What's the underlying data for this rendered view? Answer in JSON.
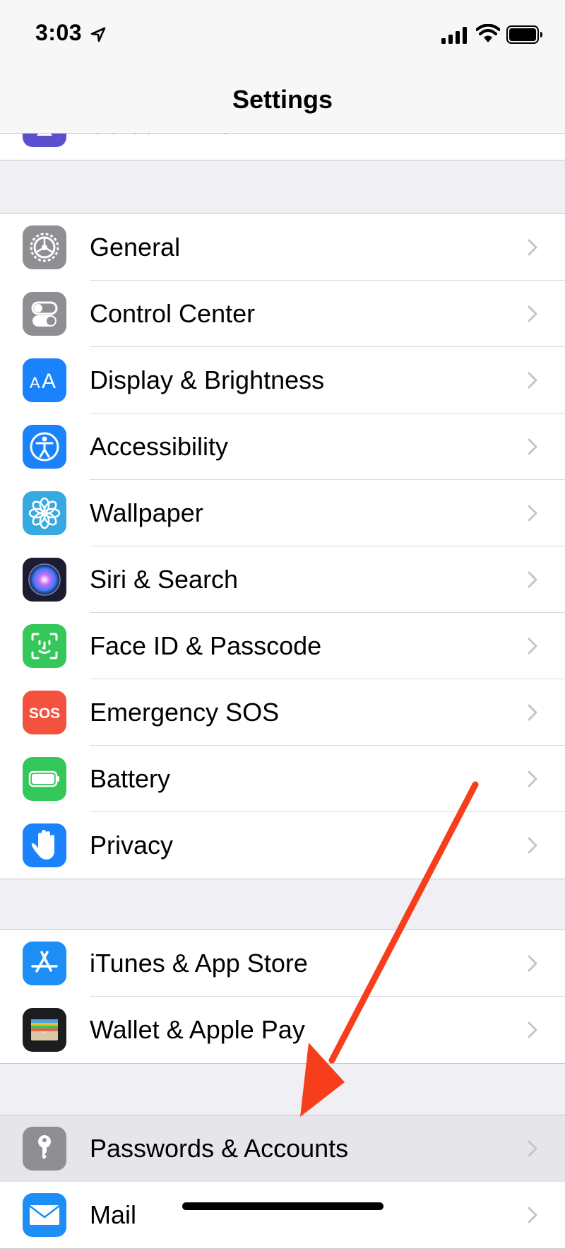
{
  "status": {
    "time": "3:03"
  },
  "nav": {
    "title": "Settings"
  },
  "top_partial": {
    "label": "Screen Time"
  },
  "groups": [
    {
      "items": [
        {
          "label": "General",
          "icon": "gear-icon",
          "color": "#8e8e93"
        },
        {
          "label": "Control Center",
          "icon": "toggles-icon",
          "color": "#8e8e93"
        },
        {
          "label": "Display & Brightness",
          "icon": "text-size-icon",
          "color": "#1a82fb"
        },
        {
          "label": "Accessibility",
          "icon": "accessibility-icon",
          "color": "#1a82fb"
        },
        {
          "label": "Wallpaper",
          "icon": "flower-icon",
          "color": "#36a9e1"
        },
        {
          "label": "Siri & Search",
          "icon": "siri-icon",
          "color": "#1c1c2e"
        },
        {
          "label": "Face ID & Passcode",
          "icon": "face-id-icon",
          "color": "#34c759"
        },
        {
          "label": "Emergency SOS",
          "icon": "sos-icon",
          "color": "#f2523e",
          "icon_text": "SOS"
        },
        {
          "label": "Battery",
          "icon": "battery-icon",
          "color": "#34c759"
        },
        {
          "label": "Privacy",
          "icon": "hand-icon",
          "color": "#1a82fb"
        }
      ]
    },
    {
      "items": [
        {
          "label": "iTunes & App Store",
          "icon": "app-store-icon",
          "color": "#1d8ef5"
        },
        {
          "label": "Wallet & Apple Pay",
          "icon": "wallet-icon",
          "color": "#1c1c1e"
        }
      ]
    },
    {
      "items": [
        {
          "label": "Passwords & Accounts",
          "icon": "key-icon",
          "color": "#8e8e93",
          "highlighted": true
        },
        {
          "label": "Mail",
          "icon": "mail-icon",
          "color": "#1d8ef5"
        }
      ]
    }
  ],
  "annotation": {
    "color": "#f73e1c"
  }
}
